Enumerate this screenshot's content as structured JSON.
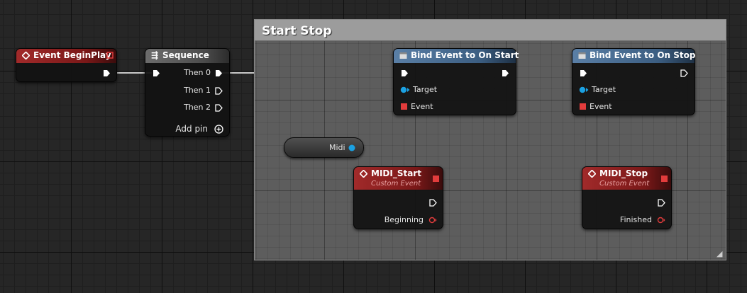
{
  "comment": {
    "title": "Start Stop"
  },
  "nodes": {
    "begin_play": {
      "title": "Event BeginPlay"
    },
    "sequence": {
      "title": "Sequence",
      "then0": "Then 0",
      "then1": "Then 1",
      "then2": "Then 2",
      "add_pin": "Add pin"
    },
    "bind_start": {
      "title": "Bind Event to On Start",
      "target": "Target",
      "event": "Event"
    },
    "bind_stop": {
      "title": "Bind Event to On Stop",
      "target": "Target",
      "event": "Event"
    },
    "midi_var": {
      "label": "Midi"
    },
    "midi_start": {
      "title": "MIDI_Start",
      "subtitle": "Custom Event",
      "output": "Beginning"
    },
    "midi_stop": {
      "title": "MIDI_Stop",
      "subtitle": "Custom Event",
      "output": "Finished"
    }
  },
  "colors": {
    "exec_wire": "#ffffff",
    "object_pin": "#1ba1e2",
    "delegate_pin": "#e23c3c",
    "event_header": "#a12a2a",
    "function_header": "#5a7fa6",
    "comment_header": "#9c9c9c"
  }
}
